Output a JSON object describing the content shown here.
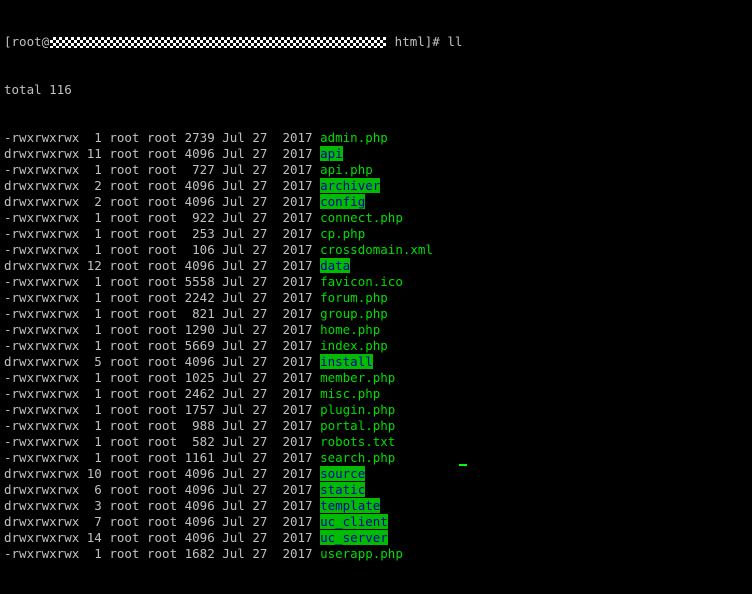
{
  "terminal": {
    "prompt_prefix": "[root@",
    "prompt_suffix": " html]# ",
    "command": "ll",
    "total_line": "total 116",
    "cursor_color": "#00ff00"
  },
  "entries": [
    {
      "meta": "-rwxrwxrwx  1 root root 2739 Jul 27  2017 ",
      "name": "admin.php",
      "type": "file"
    },
    {
      "meta": "drwxrwxrwx 11 root root 4096 Jul 27  2017 ",
      "name": "api",
      "type": "dir"
    },
    {
      "meta": "-rwxrwxrwx  1 root root  727 Jul 27  2017 ",
      "name": "api.php",
      "type": "file"
    },
    {
      "meta": "drwxrwxrwx  2 root root 4096 Jul 27  2017 ",
      "name": "archiver",
      "type": "dir"
    },
    {
      "meta": "drwxrwxrwx  2 root root 4096 Jul 27  2017 ",
      "name": "config",
      "type": "dir"
    },
    {
      "meta": "-rwxrwxrwx  1 root root  922 Jul 27  2017 ",
      "name": "connect.php",
      "type": "file"
    },
    {
      "meta": "-rwxrwxrwx  1 root root  253 Jul 27  2017 ",
      "name": "cp.php",
      "type": "file"
    },
    {
      "meta": "-rwxrwxrwx  1 root root  106 Jul 27  2017 ",
      "name": "crossdomain.xml",
      "type": "file"
    },
    {
      "meta": "drwxrwxrwx 12 root root 4096 Jul 27  2017 ",
      "name": "data",
      "type": "dir"
    },
    {
      "meta": "-rwxrwxrwx  1 root root 5558 Jul 27  2017 ",
      "name": "favicon.ico",
      "type": "file"
    },
    {
      "meta": "-rwxrwxrwx  1 root root 2242 Jul 27  2017 ",
      "name": "forum.php",
      "type": "file"
    },
    {
      "meta": "-rwxrwxrwx  1 root root  821 Jul 27  2017 ",
      "name": "group.php",
      "type": "file"
    },
    {
      "meta": "-rwxrwxrwx  1 root root 1290 Jul 27  2017 ",
      "name": "home.php",
      "type": "file"
    },
    {
      "meta": "-rwxrwxrwx  1 root root 5669 Jul 27  2017 ",
      "name": "index.php",
      "type": "file"
    },
    {
      "meta": "drwxrwxrwx  5 root root 4096 Jul 27  2017 ",
      "name": "install",
      "type": "dir"
    },
    {
      "meta": "-rwxrwxrwx  1 root root 1025 Jul 27  2017 ",
      "name": "member.php",
      "type": "file"
    },
    {
      "meta": "-rwxrwxrwx  1 root root 2462 Jul 27  2017 ",
      "name": "misc.php",
      "type": "file"
    },
    {
      "meta": "-rwxrwxrwx  1 root root 1757 Jul 27  2017 ",
      "name": "plugin.php",
      "type": "file"
    },
    {
      "meta": "-rwxrwxrwx  1 root root  988 Jul 27  2017 ",
      "name": "portal.php",
      "type": "file"
    },
    {
      "meta": "-rwxrwxrwx  1 root root  582 Jul 27  2017 ",
      "name": "robots.txt",
      "type": "file"
    },
    {
      "meta": "-rwxrwxrwx  1 root root 1161 Jul 27  2017 ",
      "name": "search.php",
      "type": "file"
    },
    {
      "meta": "drwxrwxrwx 10 root root 4096 Jul 27  2017 ",
      "name": "source",
      "type": "dir"
    },
    {
      "meta": "drwxrwxrwx  6 root root 4096 Jul 27  2017 ",
      "name": "static",
      "type": "dir"
    },
    {
      "meta": "drwxrwxrwx  3 root root 4096 Jul 27  2017 ",
      "name": "template",
      "type": "dir"
    },
    {
      "meta": "drwxrwxrwx  7 root root 4096 Jul 27  2017 ",
      "name": "uc_client",
      "type": "dir"
    },
    {
      "meta": "drwxrwxrwx 14 root root 4096 Jul 27  2017 ",
      "name": "uc_server",
      "type": "dir"
    },
    {
      "meta": "-rwxrwxrwx  1 root root 1682 Jul 27  2017 ",
      "name": "userapp.php",
      "type": "file"
    }
  ]
}
